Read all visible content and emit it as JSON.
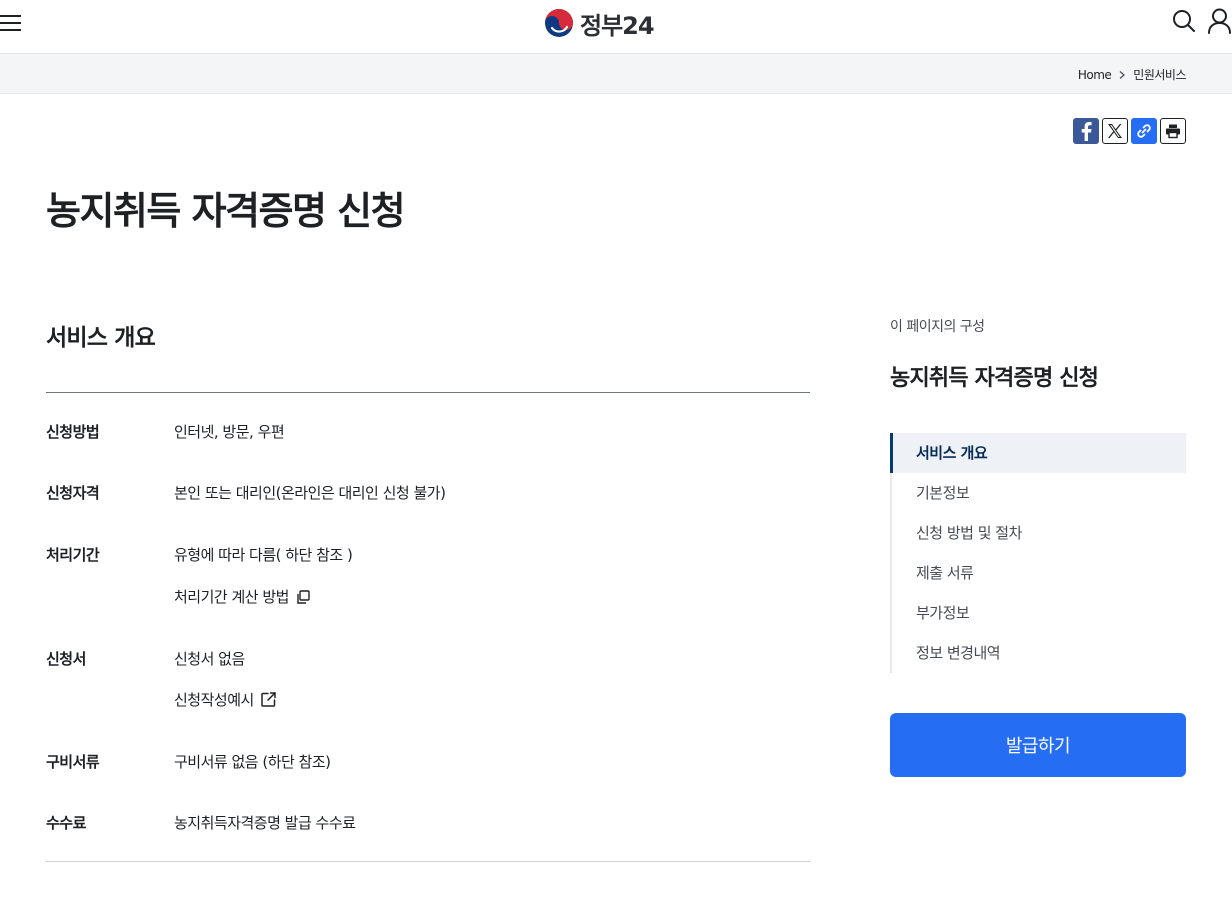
{
  "header": {
    "logo_text": "정부24",
    "menu_icon": "hamburger-menu-icon",
    "search_icon": "search-icon",
    "user_icon": "user-icon"
  },
  "breadcrumb": {
    "home": "Home",
    "current": "민원서비스"
  },
  "share": {
    "facebook_icon": "facebook-icon",
    "x_icon": "x-twitter-icon",
    "link_icon": "link-icon",
    "print_icon": "print-icon"
  },
  "page": {
    "title": "농지취득 자격증명 신청"
  },
  "overview": {
    "title": "서비스 개요",
    "rows": [
      {
        "label": "신청방법",
        "values": [
          "인터넷, 방문, 우편"
        ]
      },
      {
        "label": "신청자격",
        "values": [
          "본인 또는 대리인(온라인은 대리인 신청 불가)"
        ]
      },
      {
        "label": "처리기간",
        "values": [
          "유형에 따라 다름( 하단 참조 )",
          "처리기간 계산 방법"
        ]
      },
      {
        "label": "신청서",
        "values": [
          "신청서 없음",
          "신청작성예시"
        ]
      },
      {
        "label": "구비서류",
        "values": [
          "구비서류 없음 (하단 참조)"
        ]
      },
      {
        "label": "수수료",
        "values": [
          "농지취득자격증명 발급 수수료"
        ]
      }
    ]
  },
  "toc": {
    "caption": "이 페이지의 구성",
    "title": "농지취득 자격증명 신청",
    "items": [
      "서비스 개요",
      "기본정보",
      "신청 방법 및 절차",
      "제출 서류",
      "부가정보",
      "정보 변경내역"
    ],
    "active_index": 0
  },
  "actions": {
    "issue_label": "발급하기"
  },
  "colors": {
    "primary": "#256ef4",
    "nav_active": "#063a74",
    "facebook": "#3b5998"
  }
}
